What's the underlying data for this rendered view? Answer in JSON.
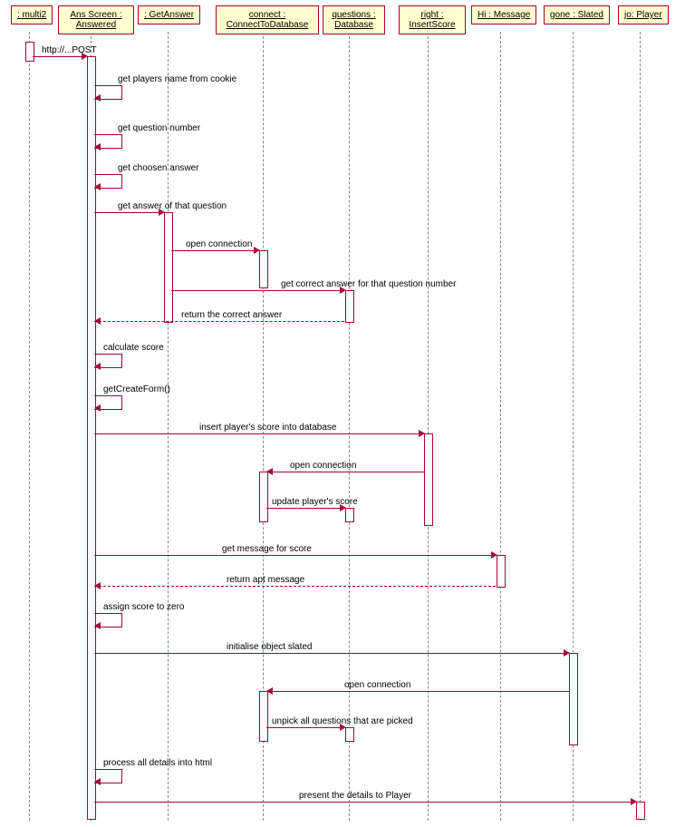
{
  "participants": {
    "p1": ": multi2",
    "p2": "Ans Screen :\nAnswered",
    "p3": ": GetAnswer",
    "p4": "connect :\nConnectToDatabase",
    "p5": "questions :\nDatabase",
    "p6": "right :\nInsertScore",
    "p7": "Hi : Message",
    "p8": "gone : Slated",
    "p9": "jo: Player"
  },
  "messages": {
    "m1": "http://...POST",
    "m2": "get players name from cookie",
    "m3": "get question number",
    "m4": "get choosen answer",
    "m5": "get answer of that question",
    "m6": "open connection",
    "m7": "get correct answer for that question number",
    "m8": "return the correct answer",
    "m9": "calculate score",
    "m10": "getCreateForm()",
    "m11": "insert player's score into database",
    "m12": "open connection",
    "m13": "update player's score",
    "m14": "get message for score",
    "m15": "return apt message",
    "m16": "assign score to zero",
    "m17": "initialise object slated",
    "m18": "open connection",
    "m19": "unpick all questions that are picked",
    "m20": "process all details into html",
    "m21": "present the details to Player"
  }
}
